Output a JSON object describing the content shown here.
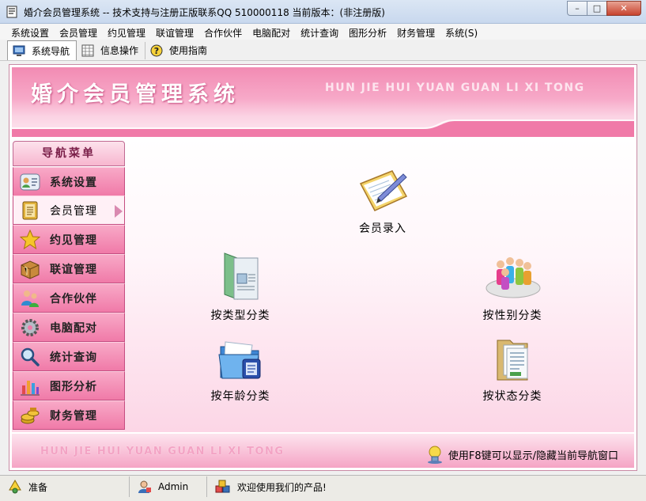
{
  "window": {
    "title": "婚介会员管理系统 -- 技术支持与注册正版联系QQ 510000118    当前版本：(非注册版)",
    "minimize": "–",
    "restore": "□",
    "close": "✕"
  },
  "menu": [
    "系统设置",
    "会员管理",
    "约见管理",
    "联谊管理",
    "合作伙伴",
    "电脑配对",
    "统计查询",
    "图形分析",
    "财务管理",
    "系统(S)"
  ],
  "toolbar": {
    "tabs": [
      {
        "label": "系统导航",
        "icon": "monitor-icon",
        "active": true
      },
      {
        "label": "信息操作",
        "icon": "grid-icon",
        "active": false
      },
      {
        "label": "使用指南",
        "icon": "help-icon",
        "active": false
      }
    ]
  },
  "banner": {
    "title": "婚介会员管理系统",
    "subtitle": "HUN JIE HUI YUAN GUAN LI XI TONG"
  },
  "nav": {
    "header": "导航菜单",
    "items": [
      {
        "label": "系统设置",
        "icon": "users-settings-icon"
      },
      {
        "label": "会员管理",
        "icon": "notebook-icon",
        "selected": true
      },
      {
        "label": "约见管理",
        "icon": "star-icon"
      },
      {
        "label": "联谊管理",
        "icon": "box-icon"
      },
      {
        "label": "合作伙伴",
        "icon": "partners-icon"
      },
      {
        "label": "电脑配对",
        "icon": "gear-icon"
      },
      {
        "label": "统计查询",
        "icon": "magnifier-icon"
      },
      {
        "label": "图形分析",
        "icon": "bar-chart-icon"
      },
      {
        "label": "财务管理",
        "icon": "coins-icon"
      }
    ]
  },
  "actions": {
    "member_entry": "会员录入",
    "by_type": "按类型分类",
    "by_gender": "按性别分类",
    "by_age": "按年龄分类",
    "by_status": "按状态分类"
  },
  "footer": {
    "text": "HUN JIE HUI YUAN GUAN LI XI TONG",
    "tip": "使用F8键可以显示/隐藏当前导航窗口"
  },
  "status": {
    "state": "准备",
    "user": "Admin",
    "message": "欢迎使用我们的产品!"
  },
  "colors": {
    "accent_pink": "#f07aa8",
    "banner_pink": "#f28bb3"
  }
}
